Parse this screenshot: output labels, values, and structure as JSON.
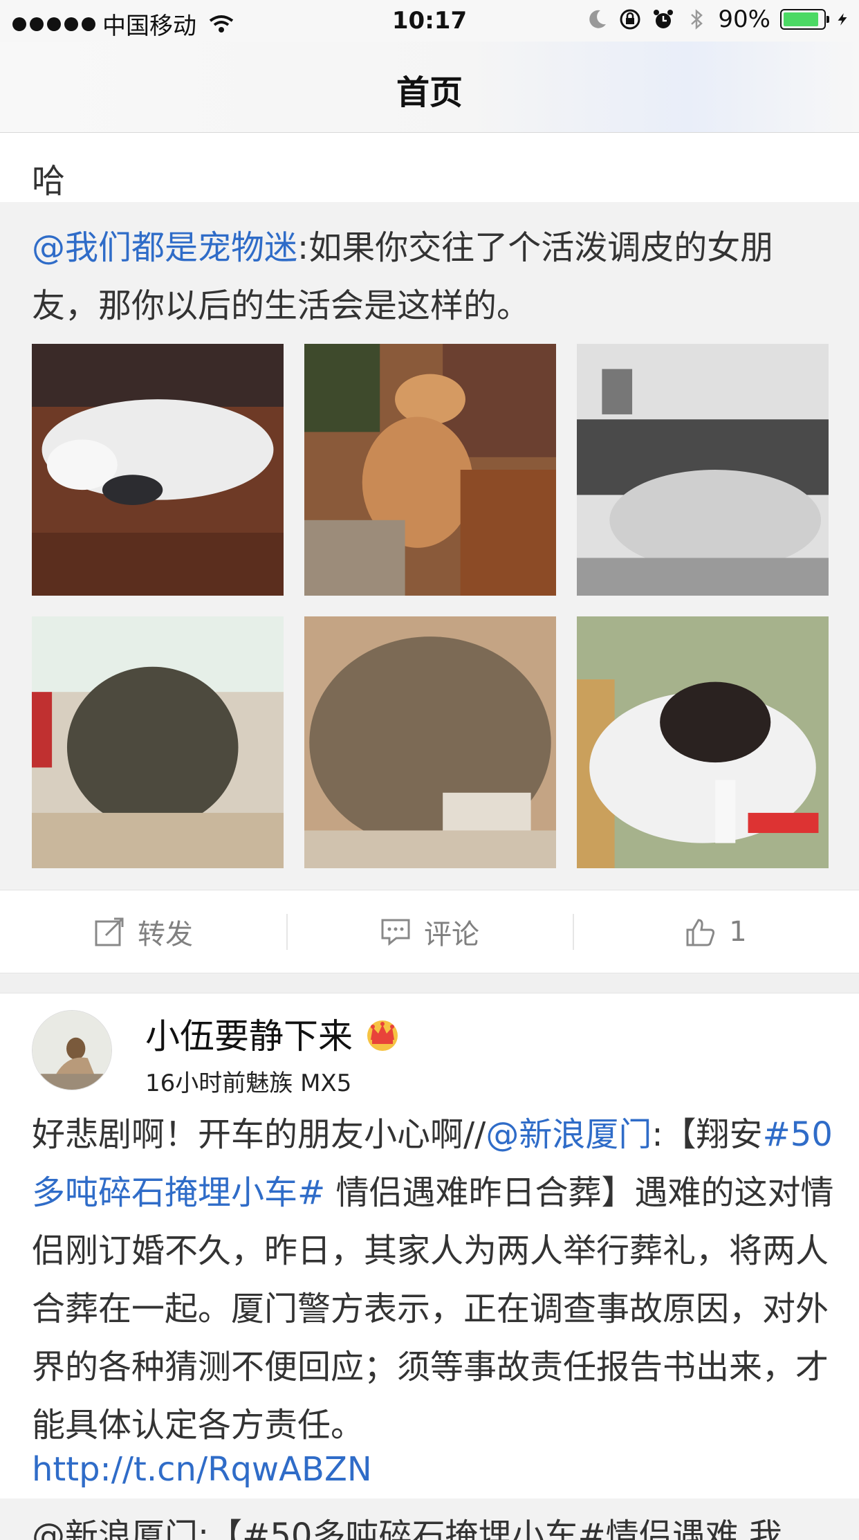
{
  "status_bar": {
    "carrier": "中国移动",
    "time": "10:17",
    "battery_percent": "90%",
    "battery_level": 0.9
  },
  "nav": {
    "title": "首页"
  },
  "previous_post": {
    "tail_text": "哈"
  },
  "retweet": {
    "mention": "@我们都是宠物迷",
    "text": ":如果你交往了个活泼调皮的女朋友，那你以后的生活会是这样的。",
    "images": [
      "samoyed-lying",
      "golden-retriever-sitting",
      "dog-on-sofa",
      "tabby-cat-on-floor",
      "tabby-cat-resting",
      "spotted-dog-chewing"
    ]
  },
  "actions": {
    "repost_label": "转发",
    "comment_label": "评论",
    "like_count": "1"
  },
  "post": {
    "username": "小伍要静下来",
    "meta": "16小时前魅族 MX5",
    "body_prefix": "好悲剧啊！开车的朋友小心啊//",
    "mention": "@新浪厦门",
    "body_middle": ":【翔安",
    "hashtag": "#50多吨碎石掩埋小车#",
    "body_rest": " 情侣遇难昨日合葬】遇难的这对情侣刚订婚不久，昨日，其家人为两人举行葬礼，将两人合葬在一起。厦门警方表示，正在调查事故原因，对外界的各种猜测不便回应；须等事故责任报告书出来，才能具体认定各方责任。",
    "link": "http://t.cn/RqwABZN",
    "next_retweet_text": "@新浪厦门:【#50多吨碎石掩埋小车#情侣遇难 我"
  },
  "colors": {
    "link_blue": "#2f6cc8",
    "battery_green": "#4cd964",
    "retweet_bg": "#f2f2f2"
  }
}
